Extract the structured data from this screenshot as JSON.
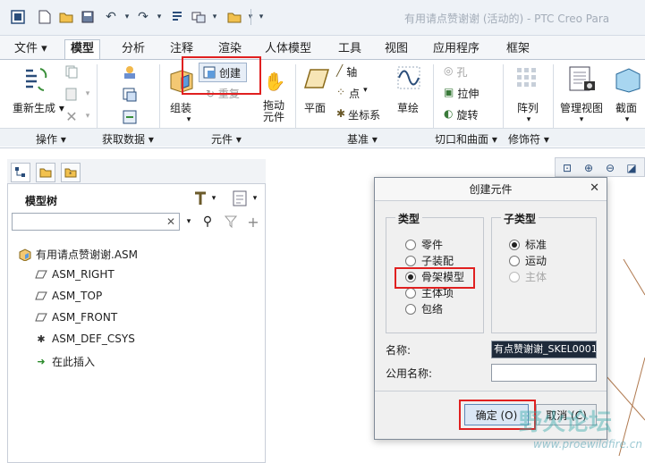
{
  "window": {
    "title": "有用请点赞谢谢 (活动的) - PTC Creo Para"
  },
  "tabs": [
    {
      "label": "文件",
      "has_dropdown": true
    },
    {
      "label": "模型",
      "active": true
    },
    {
      "label": "分析"
    },
    {
      "label": "注释"
    },
    {
      "label": "渲染"
    },
    {
      "label": "人体模型"
    },
    {
      "label": "工具"
    },
    {
      "label": "视图"
    },
    {
      "label": "应用程序"
    },
    {
      "label": "框架"
    }
  ],
  "ribbon": {
    "regen": "重新生成",
    "assemble": "组装",
    "create": "创建",
    "repeat": "重复",
    "drag_line1": "拖动",
    "drag_line2": "元件",
    "plane": "平面",
    "axis": "轴",
    "point": "点",
    "csys": "坐标系",
    "sketch": "草绘",
    "hole": "孔",
    "extrude": "拉伸",
    "revolve": "旋转",
    "pattern": "阵列",
    "manage_views": "管理视图",
    "section": "截面",
    "groups": {
      "operations": "操作",
      "get_data": "获取数据",
      "component": "元件",
      "datum": "基准",
      "cut_surface": "切口和曲面",
      "modifier": "修饰符"
    }
  },
  "model_tree": {
    "title": "模型树",
    "search_value": "",
    "items": [
      {
        "label": "有用请点赞谢谢.ASM",
        "icon": "assembly-icon"
      },
      {
        "label": "ASM_RIGHT",
        "icon": "datum-plane-icon"
      },
      {
        "label": "ASM_TOP",
        "icon": "datum-plane-icon"
      },
      {
        "label": "ASM_FRONT",
        "icon": "datum-plane-icon"
      },
      {
        "label": "ASM_DEF_CSYS",
        "icon": "csys-icon"
      },
      {
        "label": "在此插入",
        "icon": "insert-arrow-icon"
      }
    ]
  },
  "dialog": {
    "title": "创建元件",
    "type_legend": "类型",
    "types": [
      "零件",
      "子装配",
      "骨架模型",
      "主体项",
      "包络"
    ],
    "selected_type": "骨架模型",
    "subtype_legend": "子类型",
    "subtypes": [
      "标准",
      "运动",
      "主体"
    ],
    "selected_subtype": "标准",
    "disabled_subtype": "主体",
    "name_label": "名称:",
    "name_value": "有点赞谢谢_SKEL0001",
    "common_name_label": "公用名称:",
    "common_name_value": "",
    "ok_label": "确定 (O)",
    "cancel_label": "取消 (C)"
  },
  "watermark": {
    "text": "野火论坛",
    "url": "www.proewildfire.cn"
  },
  "colors": {
    "highlight_red": "#e02020",
    "accent_blue": "#2a4d7a"
  }
}
